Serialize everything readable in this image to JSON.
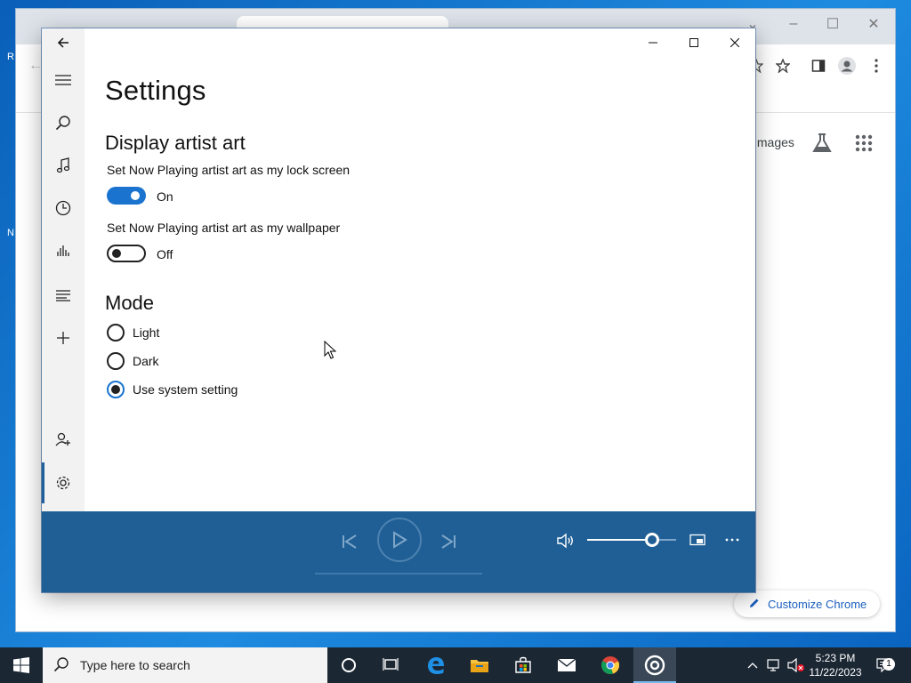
{
  "desktop": {
    "fragments": [
      "R",
      "N"
    ]
  },
  "chrome": {
    "images_link": "Images",
    "customize_label": "Customize Chrome"
  },
  "app": {
    "page_title": "Settings",
    "display_art": {
      "heading": "Display artist art",
      "lock_screen": {
        "label": "Set Now Playing artist art as my lock screen",
        "state": "On"
      },
      "wallpaper": {
        "label": "Set Now Playing artist art as my wallpaper",
        "state": "Off"
      }
    },
    "mode": {
      "heading": "Mode",
      "options": [
        "Light",
        "Dark",
        "Use system setting"
      ],
      "selected": "Use system setting"
    },
    "player": {
      "volume_fraction": 0.73
    }
  },
  "taskbar": {
    "search_placeholder": "Type here to search",
    "time": "5:23 PM",
    "date": "11/22/2023",
    "notification_count": "1"
  },
  "colors": {
    "accent": "#1a74cf",
    "player_bg": "#1f5f95",
    "taskbar_bg": "#1c2734"
  }
}
